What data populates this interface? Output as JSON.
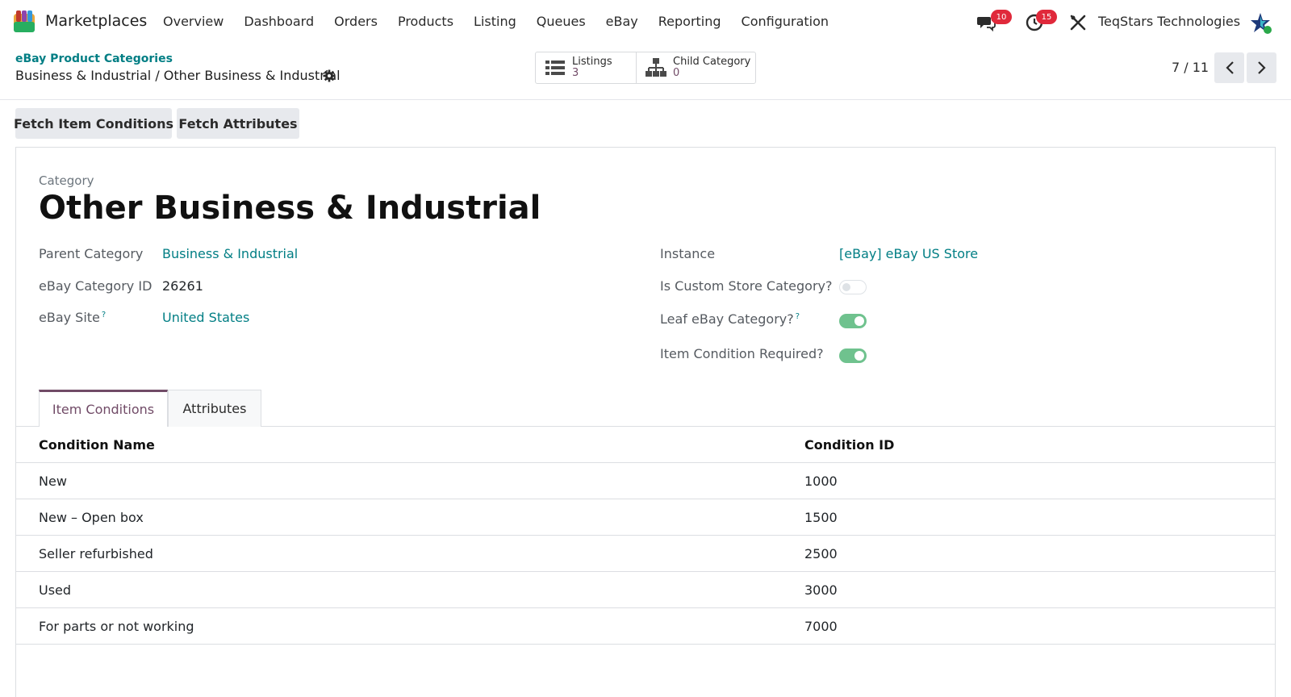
{
  "navbar": {
    "app_name": "Marketplaces",
    "menu": [
      "Overview",
      "Dashboard",
      "Orders",
      "Products",
      "Listing",
      "Queues",
      "eBay",
      "Reporting",
      "Configuration"
    ],
    "messages_count": "10",
    "activities_count": "15",
    "company": "TeqStars Technologies"
  },
  "breadcrumb": {
    "parent": "eBay Product Categories",
    "current": "Business & Industrial / Other Business & Industrial"
  },
  "smart_buttons": [
    {
      "label": "Listings",
      "value": "3",
      "icon": "list-icon"
    },
    {
      "label": "Child Category",
      "value": "0",
      "icon": "sitemap-icon"
    }
  ],
  "pager": {
    "value": "7 / 11"
  },
  "actions": {
    "fetch_conditions": "Fetch Item Conditions",
    "fetch_attributes": "Fetch Attributes"
  },
  "form": {
    "category_label": "Category",
    "category_name": "Other Business & Industrial",
    "left": {
      "parent_label": "Parent Category",
      "parent_value": "Business & Industrial",
      "id_label": "eBay Category ID",
      "id_value": "26261",
      "site_label": "eBay Site",
      "site_value": "United States"
    },
    "right": {
      "instance_label": "Instance",
      "instance_value": "[eBay] eBay US Store",
      "custom_label": "Is Custom Store Category?",
      "custom_value": false,
      "leaf_label": "Leaf eBay Category?",
      "leaf_value": true,
      "condition_required_label": "Item Condition Required?",
      "condition_required_value": true
    },
    "help_mark": "?"
  },
  "tabs": [
    {
      "label": "Item Conditions",
      "active": true
    },
    {
      "label": "Attributes",
      "active": false
    }
  ],
  "table": {
    "columns": [
      "Condition Name",
      "Condition ID"
    ],
    "rows": [
      {
        "name": "New",
        "id": "1000"
      },
      {
        "name": "New – Open box",
        "id": "1500"
      },
      {
        "name": "Seller refurbished",
        "id": "2500"
      },
      {
        "name": "Used",
        "id": "3000"
      },
      {
        "name": "For parts or not working",
        "id": "7000"
      }
    ]
  },
  "colors": {
    "accent": "#714b67",
    "link": "#017e84",
    "toggle_on": "#6fc28e",
    "badge": "#e0293b"
  }
}
